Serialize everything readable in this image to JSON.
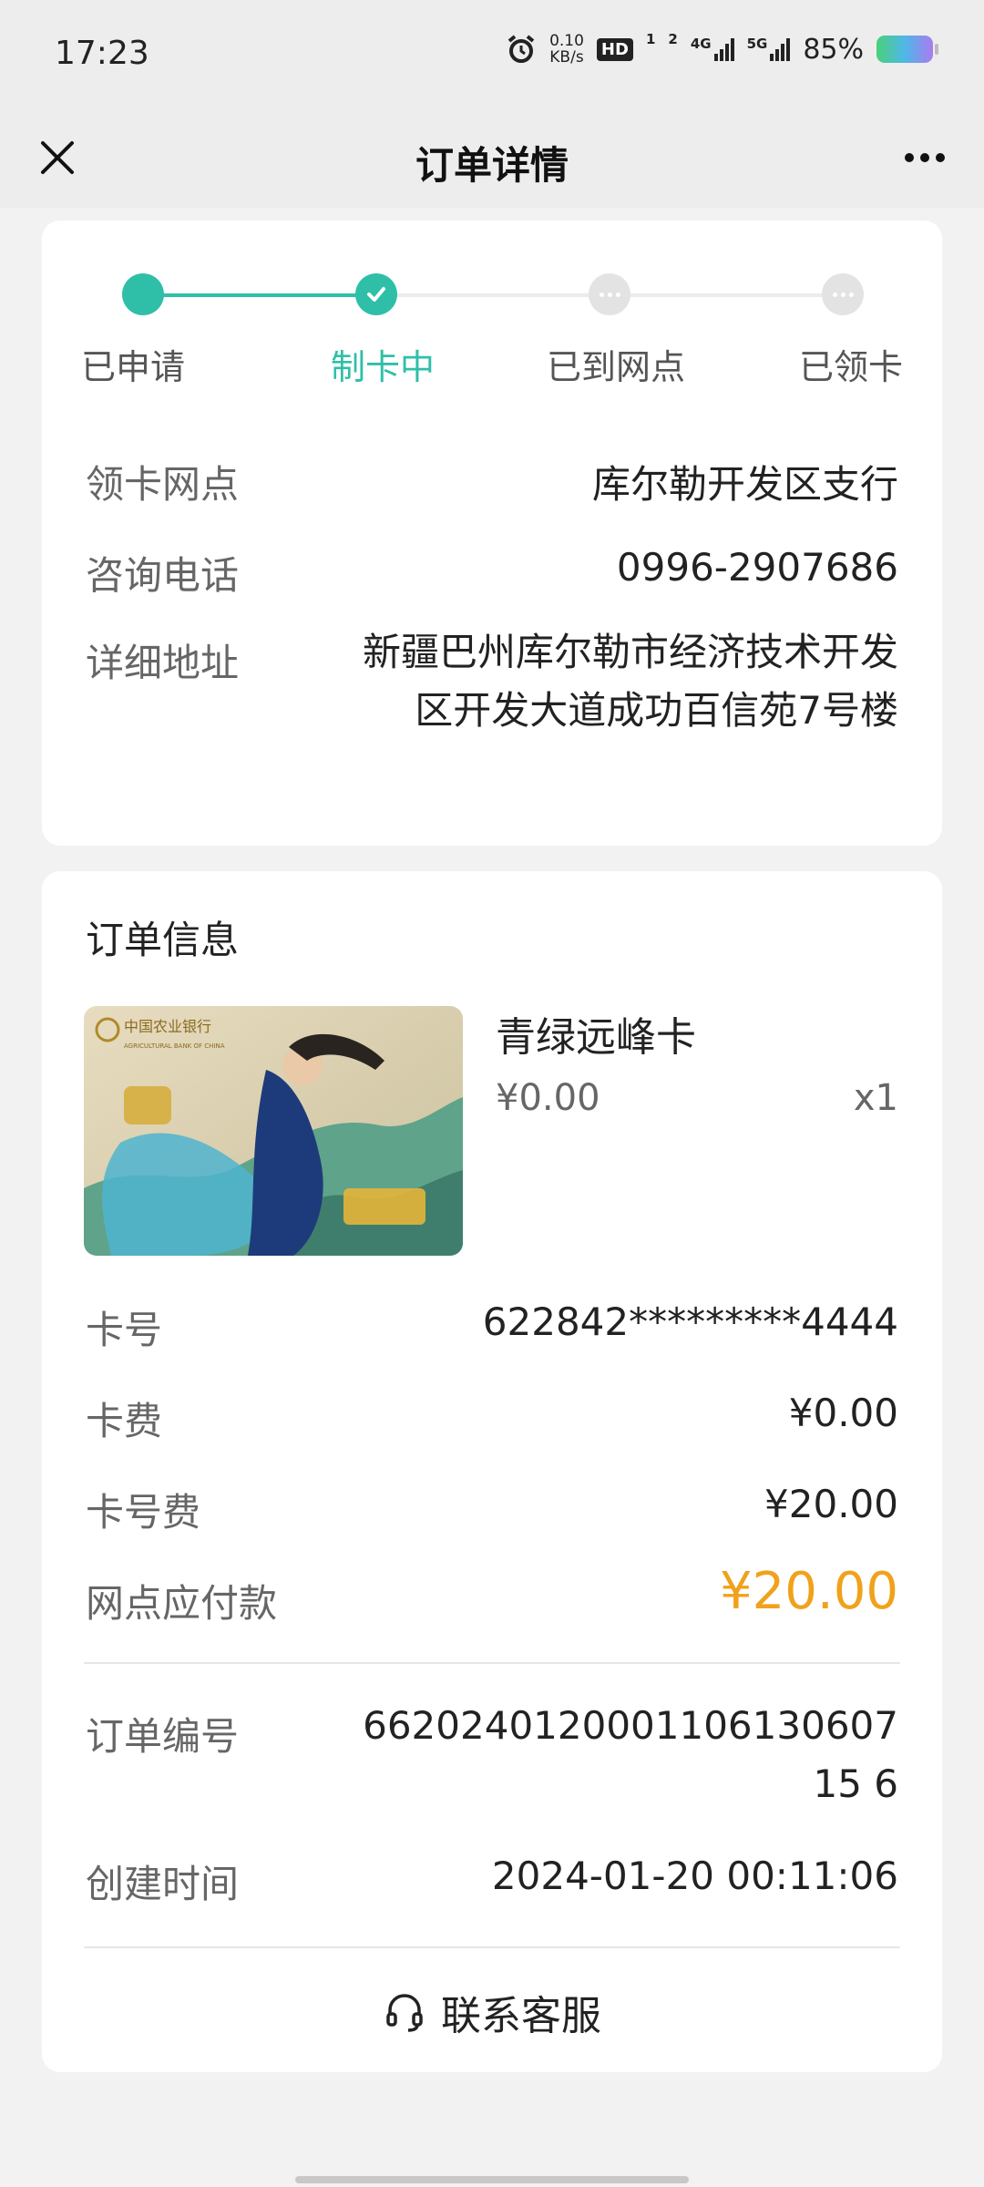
{
  "status_bar": {
    "time": "17:23",
    "net_speed_value": "0.10",
    "net_speed_unit": "KB/s",
    "hd_label": "HD",
    "hd_sim": "1",
    "hd_sim2": "2",
    "signal_4g": "4G",
    "signal_5g": "5G",
    "battery": "85%"
  },
  "nav": {
    "title": "订单详情"
  },
  "progress": {
    "steps": [
      {
        "label": "已申请",
        "state": "done"
      },
      {
        "label": "制卡中",
        "state": "current"
      },
      {
        "label": "已到网点",
        "state": "pending"
      },
      {
        "label": "已领卡",
        "state": "pending"
      }
    ],
    "accent_color": "#2fbfa8"
  },
  "branch": {
    "label": "领卡网点",
    "value": "库尔勒开发区支行"
  },
  "phone": {
    "label": "咨询电话",
    "value": "0996-2907686"
  },
  "address": {
    "label": "详细地址",
    "value": "新疆巴州库尔勒市经济技术开发区开发大道成功百信苑7号楼"
  },
  "order_info": {
    "title": "订单信息",
    "product": {
      "name": "青绿远峰卡",
      "price": "¥0.00",
      "quantity": "x1",
      "bank_name": "中国农业银行",
      "bank_name_en": "AGRICULTURAL BANK OF CHINA"
    },
    "card_number": {
      "label": "卡号",
      "value": "622842*********4444"
    },
    "card_fee": {
      "label": "卡费",
      "value": "¥0.00"
    },
    "number_fee": {
      "label": "卡号费",
      "value": "¥20.00"
    },
    "payable": {
      "label": "网点应付款",
      "value": "¥20.00",
      "color": "#f0a21c"
    },
    "order_no": {
      "label": "订单编号",
      "value": "662024012000110613060715 6"
    },
    "created": {
      "label": "创建时间",
      "value": "2024-01-20 00:11:06"
    }
  },
  "service": {
    "label": "联系客服"
  }
}
